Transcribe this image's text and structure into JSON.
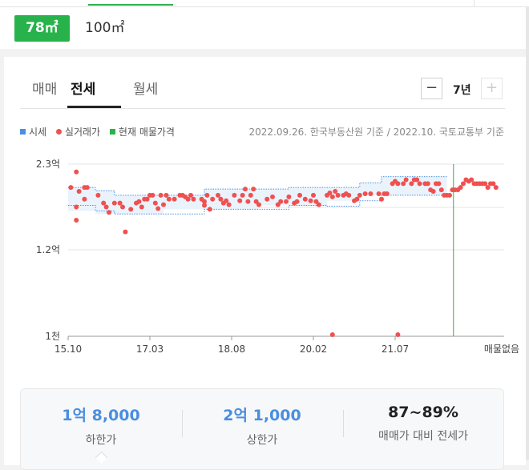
{
  "sizes": {
    "active": "78㎡",
    "inactive": "100㎡"
  },
  "tabs": [
    "매매",
    "전세",
    "월세"
  ],
  "period": {
    "label": "7년",
    "minus": "−",
    "plus": "+"
  },
  "legend": {
    "market": {
      "label": "시세",
      "color": "#4a90e2"
    },
    "actual": {
      "label": "실거래가",
      "color": "#f05050"
    },
    "listing": {
      "label": "현재 매물가격",
      "color": "#2bb24c"
    }
  },
  "source": "2022.09.26. 한국부동산원 기준 / 2022.10. 국토교통부 기준",
  "chart_data": {
    "type": "scatter",
    "x_ticks": [
      "15.10",
      "17.03",
      "18.08",
      "20.02",
      "21.07"
    ],
    "x_end_label": "매물없음",
    "y_ticks": [
      "2.3억",
      "1.2억",
      "1천"
    ],
    "y_range_labels": {
      "top": "2.3억",
      "bottom": "1천"
    },
    "band": {
      "upper": [
        [
          2015.75,
          2.0
        ],
        [
          2016.25,
          1.96
        ],
        [
          2016.6,
          1.9
        ],
        [
          2017.5,
          1.9
        ],
        [
          2018.25,
          1.98
        ],
        [
          2019.25,
          1.98
        ],
        [
          2019.8,
          2.0
        ],
        [
          2020.5,
          2.0
        ],
        [
          2021.1,
          2.06
        ],
        [
          2021.5,
          2.14
        ],
        [
          2022.7,
          2.14
        ]
      ],
      "lower": [
        [
          2015.75,
          1.77
        ],
        [
          2016.25,
          1.7
        ],
        [
          2016.6,
          1.66
        ],
        [
          2017.5,
          1.66
        ],
        [
          2018.25,
          1.72
        ],
        [
          2019.25,
          1.72
        ],
        [
          2019.8,
          1.77
        ],
        [
          2020.5,
          1.76
        ],
        [
          2021.1,
          1.83
        ],
        [
          2021.5,
          1.9
        ],
        [
          2022.7,
          1.9
        ]
      ]
    },
    "points": [
      [
        2015.8,
        2.0
      ],
      [
        2015.9,
        2.2
      ],
      [
        2015.95,
        1.95
      ],
      [
        2016.05,
        2.0
      ],
      [
        2016.1,
        2.0
      ],
      [
        2016.05,
        1.85
      ],
      [
        2015.9,
        1.75
      ],
      [
        2015.9,
        1.58
      ],
      [
        2016.3,
        1.9
      ],
      [
        2016.4,
        1.8
      ],
      [
        2016.45,
        1.75
      ],
      [
        2016.5,
        1.68
      ],
      [
        2016.6,
        1.8
      ],
      [
        2016.7,
        1.8
      ],
      [
        2016.75,
        1.75
      ],
      [
        2016.8,
        1.43
      ],
      [
        2016.9,
        1.72
      ],
      [
        2017.0,
        1.8
      ],
      [
        2017.05,
        1.82
      ],
      [
        2017.1,
        1.75
      ],
      [
        2017.15,
        1.85
      ],
      [
        2017.2,
        1.85
      ],
      [
        2017.25,
        1.9
      ],
      [
        2017.3,
        1.9
      ],
      [
        2017.35,
        1.8
      ],
      [
        2017.4,
        1.73
      ],
      [
        2017.45,
        1.9
      ],
      [
        2017.5,
        1.78
      ],
      [
        2017.55,
        1.9
      ],
      [
        2017.6,
        1.85
      ],
      [
        2017.7,
        1.85
      ],
      [
        2017.8,
        1.9
      ],
      [
        2017.85,
        1.9
      ],
      [
        2017.9,
        1.88
      ],
      [
        2017.95,
        1.85
      ],
      [
        2018.0,
        1.9
      ],
      [
        2018.05,
        1.85
      ],
      [
        2018.2,
        1.85
      ],
      [
        2018.25,
        1.77
      ],
      [
        2018.25,
        1.82
      ],
      [
        2018.3,
        1.9
      ],
      [
        2018.35,
        1.72
      ],
      [
        2018.4,
        1.85
      ],
      [
        2018.5,
        1.9
      ],
      [
        2018.55,
        1.85
      ],
      [
        2018.6,
        1.8
      ],
      [
        2018.65,
        1.83
      ],
      [
        2018.7,
        1.78
      ],
      [
        2018.8,
        1.9
      ],
      [
        2018.9,
        1.83
      ],
      [
        2018.95,
        1.9
      ],
      [
        2019.0,
        1.98
      ],
      [
        2019.05,
        1.82
      ],
      [
        2019.1,
        1.9
      ],
      [
        2019.15,
        1.98
      ],
      [
        2019.2,
        1.82
      ],
      [
        2019.25,
        1.78
      ],
      [
        2019.4,
        1.85
      ],
      [
        2019.5,
        1.88
      ],
      [
        2019.6,
        1.78
      ],
      [
        2019.65,
        1.82
      ],
      [
        2019.75,
        1.82
      ],
      [
        2019.8,
        1.88
      ],
      [
        2019.9,
        1.8
      ],
      [
        2019.95,
        1.82
      ],
      [
        2020.0,
        1.9
      ],
      [
        2020.1,
        1.85
      ],
      [
        2020.2,
        1.83
      ],
      [
        2020.25,
        1.9
      ],
      [
        2020.3,
        1.82
      ],
      [
        2020.35,
        1.78
      ],
      [
        2020.5,
        1.9
      ],
      [
        2020.55,
        1.93
      ],
      [
        2020.6,
        1.88
      ],
      [
        2020.65,
        1.95
      ],
      [
        2020.7,
        1.9
      ],
      [
        2020.8,
        1.9
      ],
      [
        2020.85,
        1.92
      ],
      [
        2020.9,
        1.9
      ],
      [
        2021.0,
        1.83
      ],
      [
        2021.05,
        1.85
      ],
      [
        2021.1,
        1.9
      ],
      [
        2021.2,
        1.92
      ],
      [
        2021.3,
        1.92
      ],
      [
        2021.45,
        1.92
      ],
      [
        2021.5,
        1.85
      ],
      [
        2021.55,
        1.92
      ],
      [
        2021.6,
        1.92
      ],
      [
        2021.7,
        2.05
      ],
      [
        2021.75,
        2.08
      ],
      [
        2021.8,
        2.05
      ],
      [
        2021.9,
        2.05
      ],
      [
        2021.95,
        2.1
      ],
      [
        2022.05,
        2.05
      ],
      [
        2022.1,
        2.1
      ],
      [
        2022.15,
        2.1
      ],
      [
        2022.2,
        2.05
      ],
      [
        2022.3,
        2.05
      ],
      [
        2022.35,
        2.05
      ],
      [
        2022.4,
        1.97
      ],
      [
        2022.45,
        1.95
      ],
      [
        2022.5,
        2.05
      ],
      [
        2022.55,
        2.05
      ],
      [
        2022.6,
        1.97
      ],
      [
        2022.65,
        1.9
      ],
      [
        2022.7,
        1.9
      ],
      [
        2022.75,
        1.9
      ],
      [
        2022.8,
        1.97
      ],
      [
        2022.85,
        1.97
      ],
      [
        2022.9,
        1.97
      ],
      [
        2022.95,
        2.0
      ],
      [
        2023.0,
        2.05
      ],
      [
        2023.05,
        2.1
      ],
      [
        2023.1,
        2.08
      ],
      [
        2023.15,
        2.1
      ],
      [
        2023.2,
        2.05
      ],
      [
        2023.25,
        2.05
      ],
      [
        2023.3,
        2.05
      ],
      [
        2023.35,
        2.05
      ],
      [
        2023.4,
        2.05
      ],
      [
        2023.45,
        2.0
      ],
      [
        2023.5,
        2.05
      ],
      [
        2023.55,
        2.05
      ],
      [
        2023.6,
        2.0
      ],
      [
        2020.6,
        0.12
      ],
      [
        2021.8,
        0.12
      ]
    ],
    "listing_line_x": 2022.82
  },
  "summary": {
    "low": {
      "value": "1억 8,000",
      "label": "하한가"
    },
    "high": {
      "value": "2억 1,000",
      "label": "상한가"
    },
    "ratio": {
      "value": "87~89%",
      "label": "매매가 대비 전세가"
    }
  }
}
